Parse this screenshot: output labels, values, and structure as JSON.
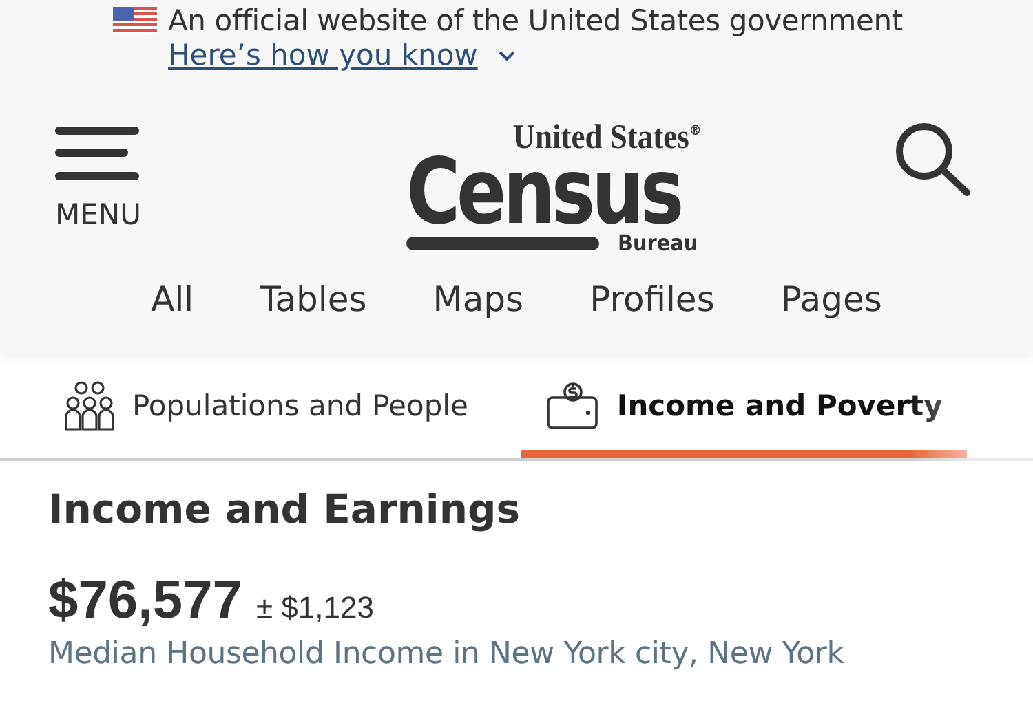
{
  "gov_banner": {
    "text": "An official website of the United States government",
    "link": "Here’s how you know"
  },
  "header": {
    "menu_label": "MENU",
    "logo": {
      "line_1": "United States",
      "registered": "®",
      "line_2": "Census",
      "line_3": "Bureau"
    }
  },
  "search_scopes": [
    "All",
    "Tables",
    "Maps",
    "Profiles",
    "Pages"
  ],
  "category_tabs": [
    {
      "label": "Populations and People",
      "kind": "people",
      "selected": false
    },
    {
      "label": "Income and Poverty",
      "kind": "wallet",
      "selected": true
    }
  ],
  "section": {
    "title": "Income and Earnings",
    "value": "$76,577",
    "margin": "± $1,123",
    "caption": "Median Household Income in New York city, New York"
  }
}
